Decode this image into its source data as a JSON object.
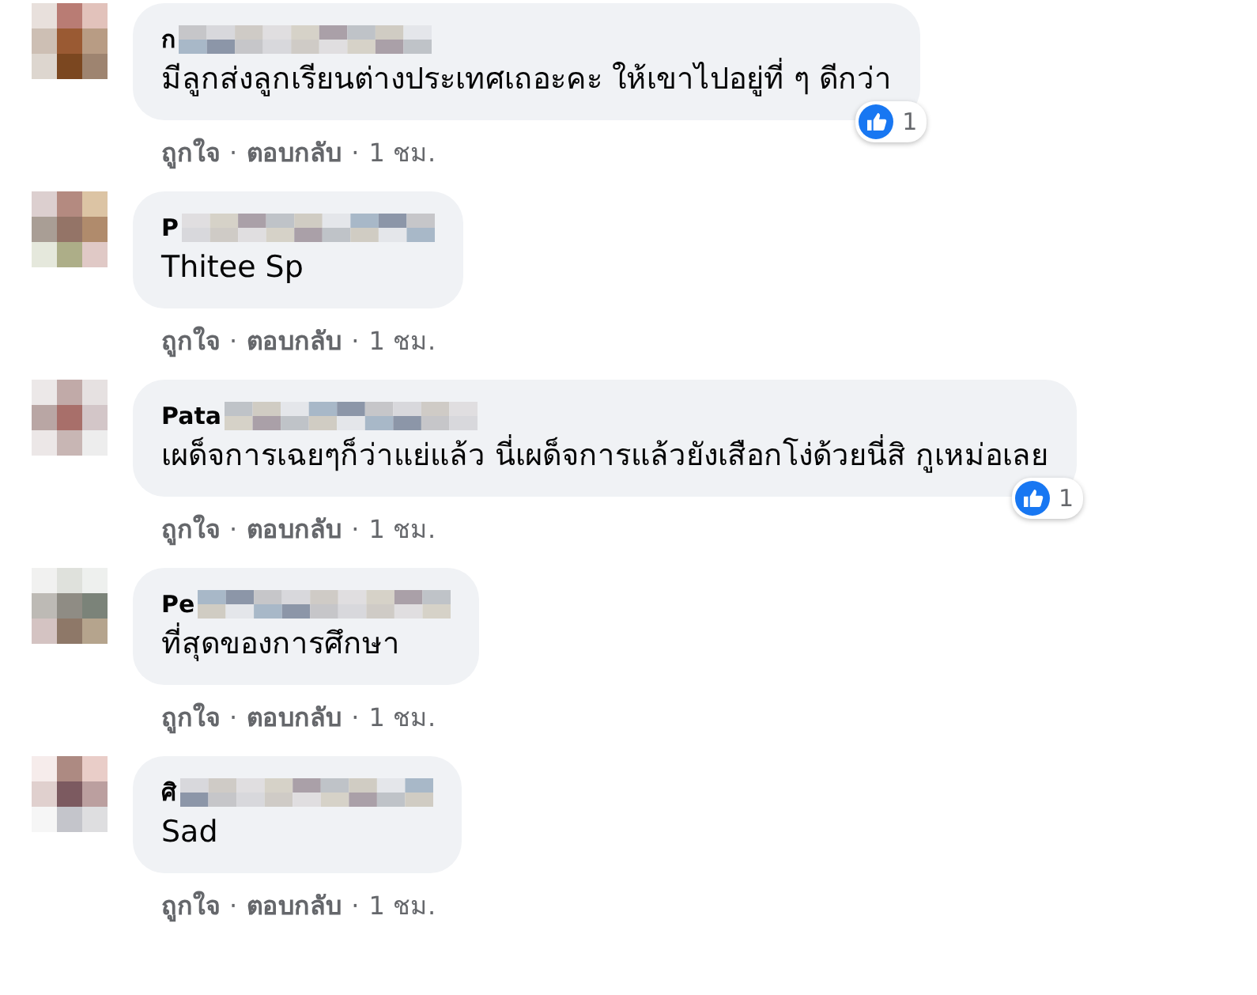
{
  "comments": [
    {
      "author": "ก",
      "text": "มีลูกส่งลูกเรียนต่างประเทศเถอะคะ ให้เขาไปอยู่ที่ ๆ ดีกว่า",
      "reactions": "1",
      "actions": {
        "like": "ถูกใจ",
        "reply": "ตอบกลับ",
        "time": "1 ชม.",
        "separator": "·"
      }
    },
    {
      "author": "P",
      "text": "Thitee Sp",
      "actions": {
        "like": "ถูกใจ",
        "reply": "ตอบกลับ",
        "time": "1 ชม.",
        "separator": "·"
      }
    },
    {
      "author": "Pata",
      "text": "เผด็จการเฉยๆก็ว่าแย่แล้ว นี่เผด็จการแล้วยังเสือกโง่ด้วยนี่สิ กูเหม่อเลย",
      "reactions": "1",
      "actions": {
        "like": "ถูกใจ",
        "reply": "ตอบกลับ",
        "time": "1 ชม.",
        "separator": "·"
      }
    },
    {
      "author": "Pe",
      "text": "ที่สุดของการศึกษา",
      "actions": {
        "like": "ถูกใจ",
        "reply": "ตอบกลับ",
        "time": "1 ชม.",
        "separator": "·"
      }
    },
    {
      "author": "ศิ",
      "text": "Sad",
      "actions": {
        "like": "ถูกใจ",
        "reply": "ตอบกลับ",
        "time": "1 ชม.",
        "separator": "·"
      }
    }
  ]
}
